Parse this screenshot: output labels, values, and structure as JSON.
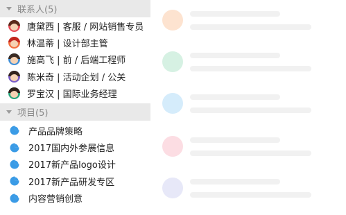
{
  "contacts_group": {
    "label": "联系人(5)",
    "items": [
      {
        "label": "唐黛西 | 客服 / 网站销售专员",
        "avatar": "avatar-woman-red",
        "hair": "#5a2a1a",
        "bg": "#e94b57"
      },
      {
        "label": "林温蒂 | 设计部主管",
        "avatar": "avatar-woman-orange",
        "hair": "#c2271f",
        "bg": "#f36f3f"
      },
      {
        "label": "施高飞 | 前 / 后端工程师",
        "avatar": "avatar-man-blue",
        "hair": "#3a2a22",
        "bg": "#3f8fd8"
      },
      {
        "label": "陈米奇 | 活动企划 / 公关",
        "avatar": "avatar-man-purple",
        "hair": "#33231d",
        "bg": "#7a5ec9"
      },
      {
        "label": "罗宝汉 | 国际业务经理",
        "avatar": "avatar-man-green",
        "hair": "#2d1f19",
        "bg": "#27a57b"
      }
    ]
  },
  "projects_group": {
    "label": "项目(5)",
    "items": [
      {
        "label": "产品品牌策略",
        "icon": "pie-chart-icon"
      },
      {
        "label": "2017国内外参展信息",
        "icon": "pie-chart-icon"
      },
      {
        "label": "2017新产品logo设计",
        "icon": "pie-chart-icon"
      },
      {
        "label": "2017新产品研发专区",
        "icon": "pie-chart-icon"
      },
      {
        "label": "内容营销创意",
        "icon": "pie-chart-icon"
      }
    ]
  },
  "colors": {
    "icon_blue": "#3a9be6",
    "placeholder_circles": [
      "#fde3d0",
      "#d6f1e3",
      "#d5ecfb",
      "#fcdde3",
      "#e7e8f8"
    ]
  }
}
